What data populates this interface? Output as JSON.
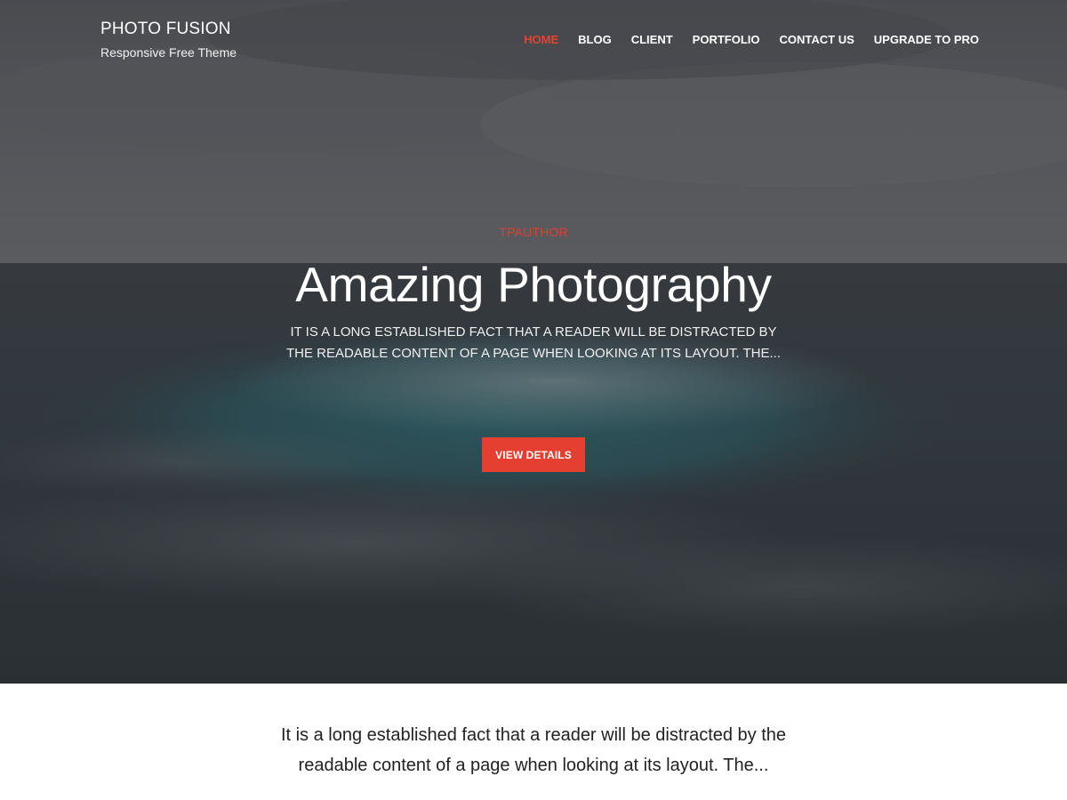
{
  "header": {
    "site_title": "PHOTO FUSION",
    "tagline": "Responsive Free Theme"
  },
  "nav": {
    "items": [
      {
        "label": "HOME",
        "active": true
      },
      {
        "label": "BLOG",
        "active": false
      },
      {
        "label": "CLIENT",
        "active": false
      },
      {
        "label": "PORTFOLIO",
        "active": false
      },
      {
        "label": "CONTACT US",
        "active": false
      },
      {
        "label": "UPGRADE TO PRO",
        "active": false
      }
    ]
  },
  "hero": {
    "author": "TPAUTHOR",
    "title": "Amazing Photography",
    "description": "IT IS A LONG ESTABLISHED FACT THAT A READER WILL BE DISTRACTED BY THE READABLE CONTENT OF A PAGE WHEN LOOKING AT ITS LAYOUT. THE...",
    "button_label": "VIEW DETAILS"
  },
  "intro": {
    "text": "It is a long established fact that a reader will be distracted by the readable content of a page when looking at its layout. The..."
  },
  "colors": {
    "accent": "#e53f32",
    "hero_overlay": "#3a3d42",
    "text_dark": "#222222"
  }
}
